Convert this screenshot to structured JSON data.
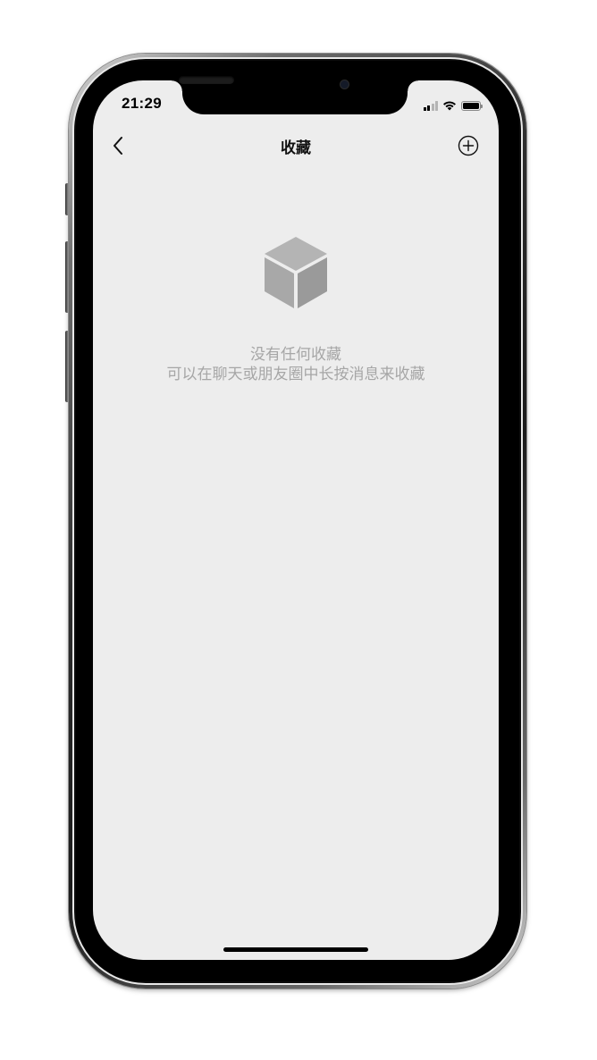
{
  "status_bar": {
    "time": "21:29",
    "signal_icon": "cellular-signal-icon",
    "wifi_icon": "wifi-icon",
    "battery_icon": "battery-icon"
  },
  "nav": {
    "title": "收藏",
    "back_icon": "chevron-left-icon",
    "add_icon": "plus-circle-icon"
  },
  "empty_state": {
    "icon": "cube-icon",
    "line1": "没有任何收藏",
    "line2": "可以在聊天或朋友圈中长按消息来收藏"
  },
  "colors": {
    "screen_background": "#ededed",
    "empty_text": "#a6a6a6",
    "cube_light": "#b6b6b6",
    "cube_dark": "#9c9c9c"
  }
}
